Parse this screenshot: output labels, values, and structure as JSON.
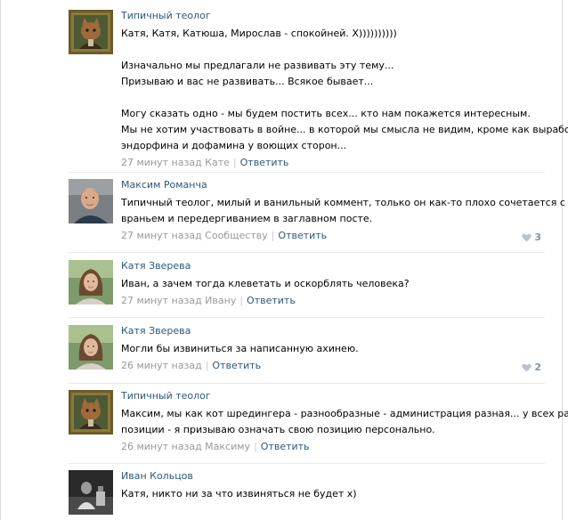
{
  "comments": [
    {
      "author": "Типичный теолог",
      "avatar": "cat-painting-avatar",
      "lines": [
        "Катя, Катя, Катюша, Мирослав - спокойней. Х))))))))))",
        "",
        "Изначально мы предлагали не развивать эту тему...",
        "Призываю и вас не развивать... Всякое бывает...",
        "",
        "Могу сказать одно - мы будем постить всех... кто нам покажется интересным.",
        "Мы не хотим участвовать в войне... в которой мы смысла не видим, кроме как выработка",
        "эндорфина и дофамина у воющих сторон..."
      ],
      "time": "27 минут назад Кате",
      "reply": "Ответить",
      "likes": ""
    },
    {
      "author": "Максим Романча",
      "avatar": "man-portrait-avatar",
      "lines": [
        "Типичный теолог, милый и ванильный коммент, только он как-то плохо сочетается с",
        "враньем и передергиванием в заглавном посте."
      ],
      "time": "27 минут назад Сообществу",
      "reply": "Ответить",
      "likes": "3"
    },
    {
      "author": "Катя Зверева",
      "avatar": "woman-portrait-avatar",
      "lines": [
        "Иван, а зачем тогда клеветать и оскорблять человека?"
      ],
      "time": "27 минут назад Ивану",
      "reply": "Ответить",
      "likes": ""
    },
    {
      "author": "Катя Зверева",
      "avatar": "woman-portrait-avatar",
      "lines": [
        "Могли бы извиниться за написанную ахинею."
      ],
      "time": "26 минут назад",
      "reply": "Ответить",
      "likes": "2"
    },
    {
      "author": "Типичный теолог",
      "avatar": "cat-painting-avatar",
      "lines": [
        "Максим, мы как кот шредингера - разнообразные - администрация разная... у всех разные",
        "позиции - я призываю означать свою позицию персонально."
      ],
      "time": "26 минут назад Максиму",
      "reply": "Ответить",
      "likes": ""
    },
    {
      "author": "Иван Кольцов",
      "avatar": "bw-photo-avatar",
      "lines": [
        "Катя, никто ни за что извиняться не будет х)"
      ],
      "time": "",
      "reply": "",
      "likes": ""
    }
  ],
  "colors": {
    "link": "#2b587a",
    "meta": "#999999",
    "divider": "#e7eaed",
    "like": "#8093a8"
  }
}
